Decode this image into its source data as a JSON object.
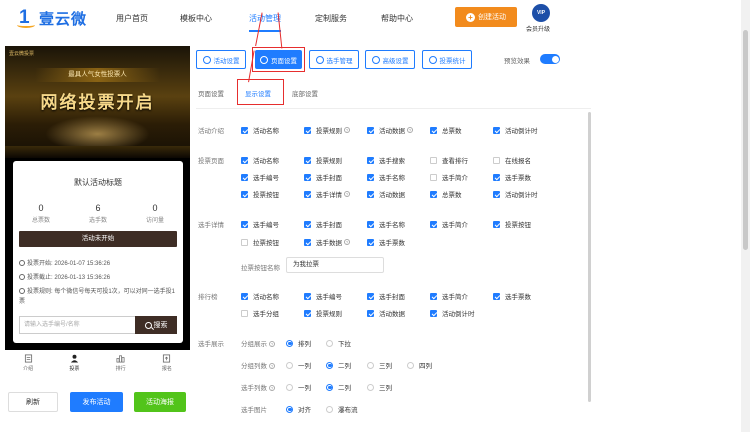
{
  "brand": {
    "logo_text": "壹云微",
    "logo_mark": "1"
  },
  "nav": {
    "items": [
      "用户首页",
      "模板中心",
      "活动管理",
      "定制服务",
      "帮助中心"
    ],
    "create_button": "创建活动",
    "vip_badge": "VIP",
    "vip_label": "会员升级"
  },
  "preview": {
    "brand_small": "壹云微投票",
    "ribbon": "最具人气女性投票人",
    "headline": "网络投票开启",
    "activity_title": "默认活动标题",
    "stats": [
      {
        "value": "0",
        "label": "总票数"
      },
      {
        "value": "6",
        "label": "选手数"
      },
      {
        "value": "0",
        "label": "访问量"
      }
    ],
    "status": "活动未开始",
    "vote_start": "投票开始: 2026-01-07 15:36:26",
    "vote_end": "投票截止: 2026-01-13 15:36:26",
    "vote_rule": "投票规则: 每个微信号每天可投1次，可以对同一选手投1票",
    "search_placeholder": "请输入选手编号/名称",
    "search_button": "搜索",
    "tabs": [
      "介绍",
      "投票",
      "排行",
      "报名"
    ]
  },
  "bottom_buttons": {
    "refresh": "刷新",
    "publish": "发布活动",
    "poster": "活动海报"
  },
  "toolbar": {
    "buttons": [
      "活动设置",
      "页面设置",
      "选手管理",
      "高级设置",
      "投票统计"
    ],
    "preview_label": "预览效果"
  },
  "subtabs": [
    "页面设置",
    "显示设置",
    "底部设置"
  ],
  "sections": {
    "intro": {
      "label": "活动介绍",
      "items": [
        "活动名称",
        "投票规则",
        "活动数据",
        "总票数",
        "活动倒计时"
      ]
    },
    "vote_page": {
      "label": "投票页面",
      "rows": [
        [
          "活动名称",
          "投票规则",
          "选手搜索",
          "查看排行",
          "在线报名"
        ],
        [
          "选手编号",
          "选手封面",
          "选手名称",
          "选手简介",
          "选手票数"
        ],
        [
          "投票按钮",
          "选手详情",
          "活动数据",
          "总票数",
          "活动倒计时"
        ]
      ]
    },
    "player_detail": {
      "label": "选手详情",
      "rows": [
        [
          "选手编号",
          "选手封面",
          "选手名称",
          "选手简介",
          "投票按钮"
        ],
        [
          "拉票按钮",
          "选手数据",
          "选手票数"
        ]
      ],
      "canvass_label": "拉票按钮名称",
      "canvass_value": "为我拉票"
    },
    "ranking": {
      "label": "排行榜",
      "rows": [
        [
          "活动名称",
          "选手编号",
          "选手封面",
          "选手简介",
          "选手票数"
        ],
        [
          "选手分组",
          "投票规则",
          "活动数据",
          "活动倒计时"
        ]
      ]
    },
    "player_display": {
      "label": "选手展示",
      "group_display": {
        "label": "分组展示",
        "options": [
          "排列",
          "下拉"
        ]
      },
      "group_columns": {
        "label": "分组列数",
        "options": [
          "一列",
          "二列",
          "三列",
          "四列"
        ]
      },
      "player_columns": {
        "label": "选手列数",
        "options": [
          "一列",
          "二列",
          "三列"
        ]
      },
      "player_image": {
        "label": "选手图片",
        "options": [
          "对齐",
          "瀑布流"
        ]
      }
    }
  },
  "colors": {
    "primary": "#1f7cff",
    "orange": "#f28b1d",
    "highlight": "#e62e2e",
    "green": "#52c41a"
  }
}
